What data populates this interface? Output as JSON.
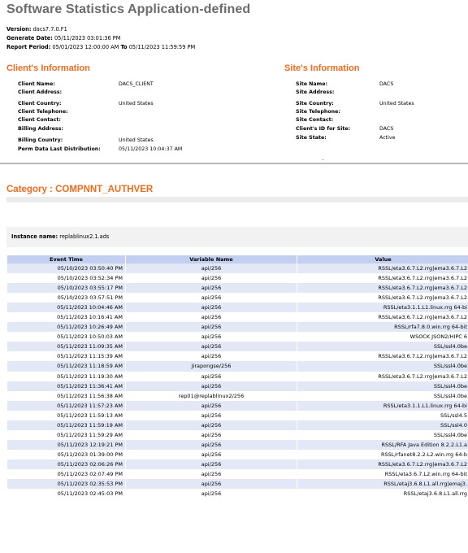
{
  "report": {
    "title": "Software Statistics Application-defined",
    "version_label": "Version:",
    "version": "dacs7.7.0.F1",
    "generate_label": "Generate Date:",
    "generate_date": "05/11/2023 03:01:36 PM",
    "period_label": "Report Period:",
    "period_from": "05/01/2023 12:00:00 AM",
    "period_to_word": "To",
    "period_to": "05/11/2023 11:59:59 PM"
  },
  "client": {
    "heading": "Client's Information",
    "rows": [
      {
        "label": "Client Name:",
        "value": "DACS_CLIENT"
      },
      {
        "label": "Client Address:",
        "value": ""
      },
      {
        "label": "Client Country:",
        "value": "United States"
      },
      {
        "label": "Client Telephone:",
        "value": ""
      },
      {
        "label": "Client Contact:",
        "value": ""
      },
      {
        "label": "Billing Address:",
        "value": ""
      },
      {
        "label": "Billing Country:",
        "value": "United States"
      },
      {
        "label": "Perm Data Last Distribution:",
        "value": "05/11/2023 10:04:37 AM"
      }
    ]
  },
  "site": {
    "heading": "Site's Information",
    "rows": [
      {
        "label": "Site Name:",
        "value": "DACS"
      },
      {
        "label": "Site Address:",
        "value": ""
      },
      {
        "label": "Site Country:",
        "value": "United States"
      },
      {
        "label": "Site Telephone:",
        "value": ""
      },
      {
        "label": "Site Contact:",
        "value": ""
      },
      {
        "label": "Client's ID for Site:",
        "value": "DACS"
      },
      {
        "label": "Site State:",
        "value": "Active"
      }
    ]
  },
  "category": {
    "title": "Category : COMPNNT_AUTHVER",
    "instance_label": "Instance name:",
    "instance_name": "replablinux2.1.ads"
  },
  "table": {
    "headers": [
      "Event Time",
      "Variable Name",
      "Value"
    ],
    "rows": [
      [
        "05/10/2023 03:50:40 PM",
        "api/256",
        "RSSL/eta3.6.7.L2.rrg|ema3.6.7.L2"
      ],
      [
        "05/10/2023 03:52:34 PM",
        "api/256",
        "RSSL/eta3.6.7.L2.rrg|ema3.6.7.L2"
      ],
      [
        "05/10/2023 03:55:17 PM",
        "api/256",
        "RSSL/eta3.6.7.L2.rrg|ema3.6.7.L2"
      ],
      [
        "05/10/2023 03:57:51 PM",
        "api/256",
        "RSSL/eta3.6.7.L2.rrg|ema3.6.7.L2"
      ],
      [
        "05/11/2023 10:04:46 AM",
        "api/256",
        "RSSL/eta3.1.1.L1.linux.rrg 64-bi"
      ],
      [
        "05/11/2023 10:16:41 AM",
        "api/256",
        "RSSL/eta3.6.7.L2.rrg|ema3.6.7.L2"
      ],
      [
        "05/11/2023 10:26:49 AM",
        "api/256",
        "RSSL/rfa7.8.0.win.rrg 64-bit"
      ],
      [
        "05/11/2023 10:50:03 AM",
        "api/256",
        "WSOCK JSON2/HIPC 6"
      ],
      [
        "05/11/2023 11:09:35 AM",
        "api/256",
        "SSL/ssl4.0be"
      ],
      [
        "05/11/2023 11:15:39 AM",
        "api/256",
        "RSSL/eta3.6.7.L2.rrg|ema3.6.7.L2"
      ],
      [
        "05/11/2023 11:18:59 AM",
        "Jirapongse/256",
        "SSL/ssl4.0be"
      ],
      [
        "05/11/2023 11:19:30 AM",
        "api/256",
        "RSSL/eta3.6.7.L2.rrg|ema3.6.7.L2"
      ],
      [
        "05/11/2023 11:36:41 AM",
        "api/256",
        "SSL/ssl4.0be"
      ],
      [
        "05/11/2023 11:56:38 AM",
        "rep01@replablinux2/256",
        "SSL/ssl4.0be"
      ],
      [
        "05/11/2023 11:57:23 AM",
        "api/256",
        "RSSL/eta3.1.1.L1.linux.rrg 64-bi"
      ],
      [
        "05/11/2023 11:59:13 AM",
        "api/256",
        "SSL/ssl4.5"
      ],
      [
        "05/11/2023 11:59:19 AM",
        "api/256",
        "SSL/ssl4.0"
      ],
      [
        "05/11/2023 11:59:29 AM",
        "api/256",
        "SSL/ssl4.0be"
      ],
      [
        "05/11/2023 12:19:21 PM",
        "api/256",
        "RSSL/RFA Java Edition 8.2.2.L1.a"
      ],
      [
        "05/11/2023 01:39:00 PM",
        "api/256",
        "RSSL/rfanet8.2.2.L2.win.rrg 64-b"
      ],
      [
        "05/11/2023 02:06:26 PM",
        "api/256",
        "RSSL/eta3.6.7.L2.rrg|ema3.6.7.L2"
      ],
      [
        "05/11/2023 02:07:49 PM",
        "api/256",
        "RSSL/eta3.6.7.L2.win.rrg 64-bit"
      ],
      [
        "05/11/2023 02:35:53 PM",
        "api/256",
        "RSSL/etaj3.6.8.L1.all.rrg|emaj3."
      ],
      [
        "05/11/2023 02:45:03 PM",
        "api/256",
        "RSSL/etaj3.6.8.L1.all.rrg"
      ]
    ]
  }
}
